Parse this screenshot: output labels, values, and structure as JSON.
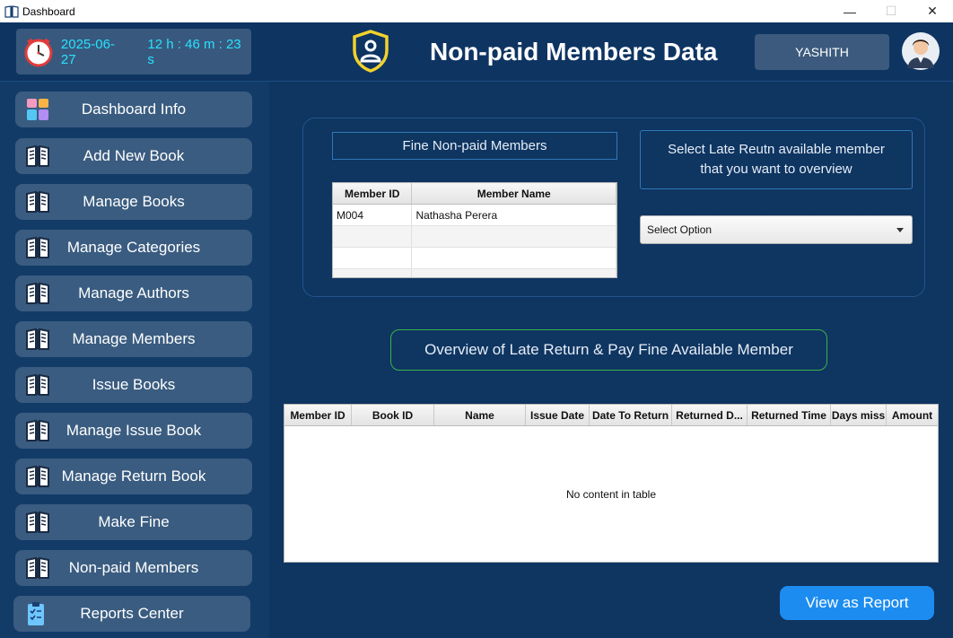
{
  "window": {
    "title": "Dashboard",
    "minimize": "—",
    "maximize": "☐",
    "close": "✕"
  },
  "header": {
    "date": "2025-06-27",
    "time": "12 h : 46 m : 23 s",
    "title": "Non-paid Members Data",
    "user": "YASHITH"
  },
  "sidebar": {
    "items": [
      {
        "label": "Dashboard Info",
        "icon": "dashboard-grid-icon"
      },
      {
        "label": "Add New Book",
        "icon": "book-icon"
      },
      {
        "label": "Manage Books",
        "icon": "book-icon"
      },
      {
        "label": "Manage Categories",
        "icon": "book-icon"
      },
      {
        "label": "Manage Authors",
        "icon": "book-icon"
      },
      {
        "label": "Manage Members",
        "icon": "book-icon"
      },
      {
        "label": "Issue Books",
        "icon": "book-icon"
      },
      {
        "label": "Manage Issue Book",
        "icon": "book-icon"
      },
      {
        "label": "Manage Return Book",
        "icon": "book-icon"
      },
      {
        "label": "Make Fine",
        "icon": "book-icon"
      },
      {
        "label": "Non-paid Members",
        "icon": "book-icon"
      },
      {
        "label": "Reports Center",
        "icon": "clipboard-icon"
      }
    ]
  },
  "main": {
    "fine_label": "Fine Non-paid Members",
    "select_label_line1": "Select Late Reutn available member",
    "select_label_line2": "that you want to  overview",
    "members_table": {
      "columns": [
        "Member ID",
        "Member Name"
      ],
      "rows": [
        [
          "M004",
          "Nathasha Perera"
        ]
      ]
    },
    "dropdown_value": "Select Option",
    "overview_label": "Overview of Late Return & Pay Fine Available Member",
    "details_table": {
      "columns": [
        "Member ID",
        "Book ID",
        "Name",
        "Issue Date",
        "Date To Return",
        "Returned D...",
        "Returned Time",
        "Days miss",
        "Amount"
      ],
      "empty_text": "No content in table"
    },
    "report_button": "View as Report"
  },
  "colors": {
    "background": "#0f3561",
    "accent": "#1c8cf0",
    "clock_text": "#29e0ff",
    "overview_border": "#3bb34a"
  }
}
